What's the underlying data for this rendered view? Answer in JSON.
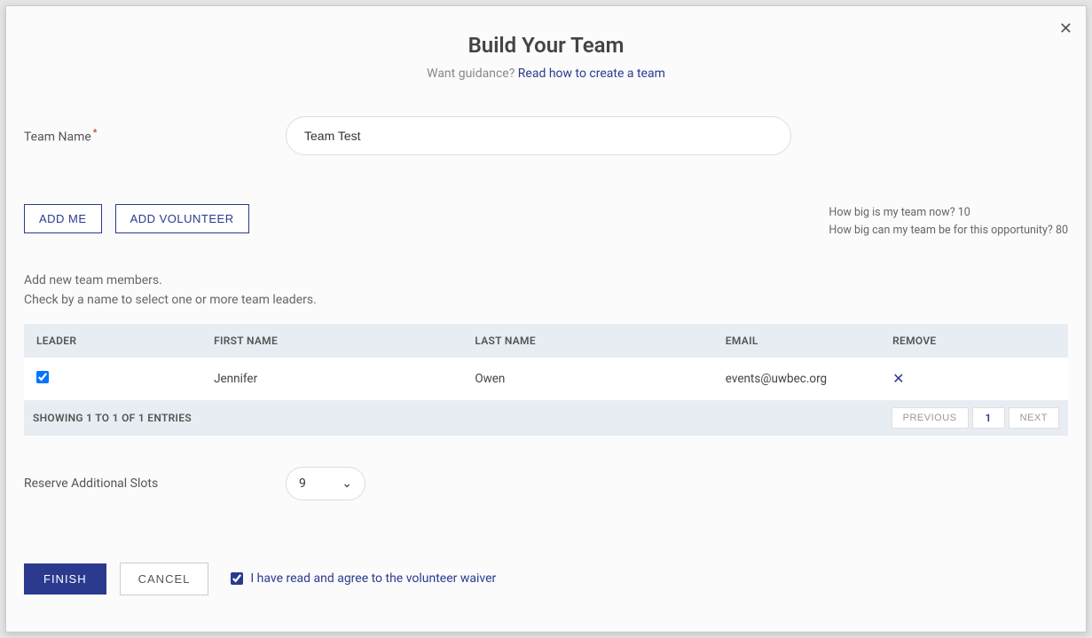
{
  "modal": {
    "title": "Build Your Team",
    "guidance_prefix": "Want guidance? ",
    "guidance_link": "Read how to create a team"
  },
  "team_name": {
    "label": "Team Name",
    "value": "Team Test"
  },
  "buttons": {
    "add_me": "ADD ME",
    "add_volunteer": "ADD VOLUNTEER",
    "finish": "FINISH",
    "cancel": "CANCEL",
    "previous": "PREVIOUS",
    "next": "NEXT"
  },
  "info": {
    "size_now_label": "How big is my team now? ",
    "size_now_value": "10",
    "size_max_label": "How big can my team be for this opportunity? ",
    "size_max_value": "80"
  },
  "hints": {
    "line1": "Add new team members.",
    "line2": "Check by a name to select one or more team leaders."
  },
  "table": {
    "headers": {
      "leader": "LEADER",
      "first_name": "FIRST NAME",
      "last_name": "LAST NAME",
      "email": "EMAIL",
      "remove": "REMOVE"
    },
    "rows": [
      {
        "leader_checked": true,
        "first_name": "Jennifer",
        "last_name": "Owen",
        "email": "events@uwbec.org"
      }
    ],
    "footer_text": "SHOWING 1 TO 1 OF 1 ENTRIES",
    "page": "1"
  },
  "reserve": {
    "label": "Reserve Additional Slots",
    "value": "9"
  },
  "waiver": {
    "label": "I have read and agree to the volunteer waiver",
    "checked": true
  }
}
